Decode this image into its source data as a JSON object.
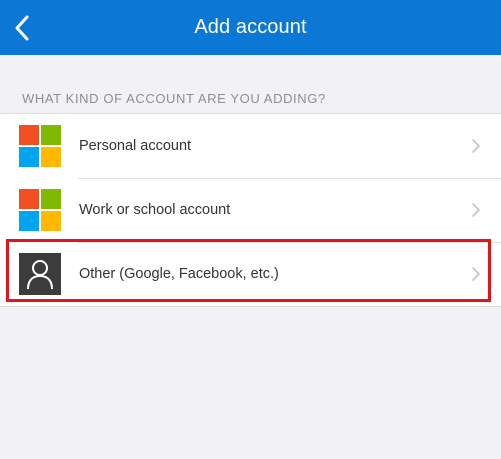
{
  "header": {
    "title": "Add account",
    "back_icon": "chevron-left-icon",
    "background_color": "#0a78d4"
  },
  "section": {
    "label": "WHAT KIND OF ACCOUNT ARE YOU ADDING?"
  },
  "accounts": [
    {
      "label": "Personal account",
      "icon": "microsoft-logo-icon"
    },
    {
      "label": "Work or school account",
      "icon": "microsoft-logo-icon"
    },
    {
      "label": "Other (Google, Facebook, etc.)",
      "icon": "person-icon"
    }
  ],
  "highlight": {
    "target": "Other (Google, Facebook, etc.)",
    "color": "#e3151a"
  }
}
